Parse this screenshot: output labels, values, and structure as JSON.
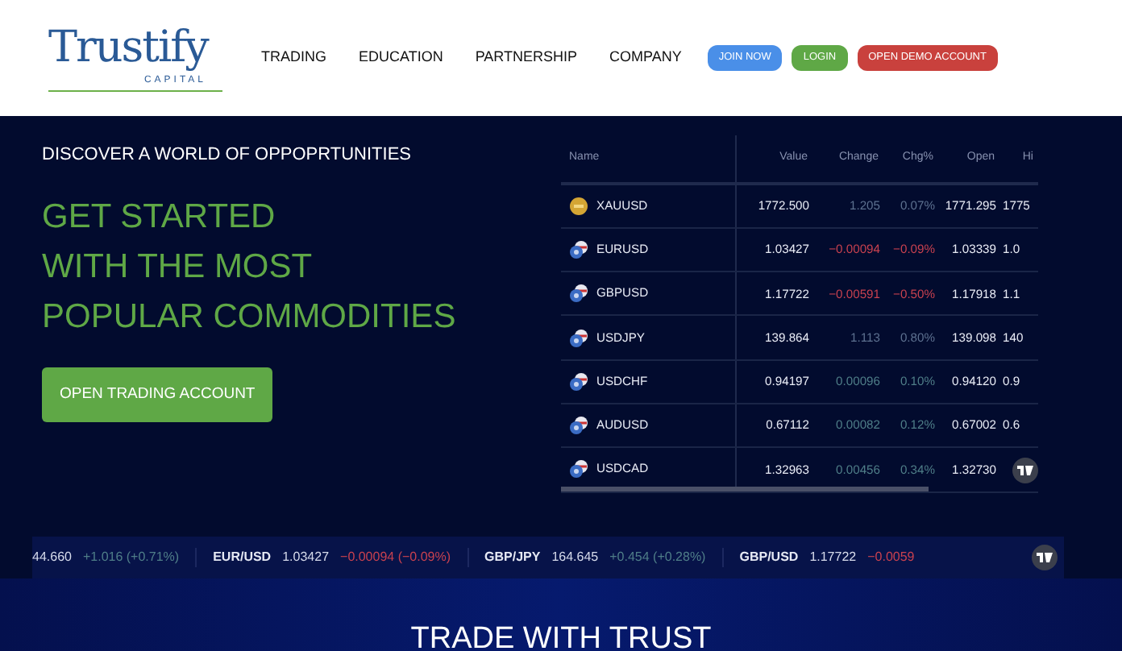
{
  "header": {
    "logo": {
      "wordmark": "Trustify",
      "tagline": "CAPITAL"
    },
    "nav": [
      {
        "label": "TRADING"
      },
      {
        "label": "EDUCATION"
      },
      {
        "label": "PARTNERSHIP"
      },
      {
        "label": "COMPANY"
      }
    ],
    "buttons": [
      {
        "label": "JOIN NOW",
        "kind": "join"
      },
      {
        "label": "LOGIN",
        "kind": "login"
      },
      {
        "label": "OPEN DEMO ACCOUNT",
        "kind": "demo"
      }
    ]
  },
  "hero": {
    "eyebrow": "DISCOVER A WORLD OF OPPOPRTUNITIES",
    "headline": [
      "GET STARTED",
      "WITH THE MOST",
      "POPULAR COMMODITIES"
    ],
    "cta": "OPEN TRADING ACCOUNT"
  },
  "quotes_table": {
    "columns": [
      "Name",
      "Value",
      "Change",
      "Chg%",
      "Open",
      "Hi"
    ],
    "rows": [
      {
        "symbol": "XAUUSD",
        "kind": "gold",
        "color": "#5d7190",
        "value": "1772.500",
        "change": "1.205",
        "change_pct": "0.07%",
        "open": "1771.295",
        "high": "1775"
      },
      {
        "symbol": "EURUSD",
        "kind": "fx",
        "color": "#c8414f",
        "value": "1.03427",
        "change": "−0.00094",
        "change_pct": "−0.09%",
        "open": "1.03339",
        "high": "1.0"
      },
      {
        "symbol": "GBPUSD",
        "kind": "fx",
        "color": "#c8414f",
        "value": "1.17722",
        "change": "−0.00591",
        "change_pct": "−0.50%",
        "open": "1.17918",
        "high": "1.1"
      },
      {
        "symbol": "USDJPY",
        "kind": "fx",
        "color": "#5d7190",
        "value": "139.864",
        "change": "1.113",
        "change_pct": "0.80%",
        "open": "139.098",
        "high": "140"
      },
      {
        "symbol": "USDCHF",
        "kind": "fx",
        "color": "#4f7e88",
        "value": "0.94197",
        "change": "0.00096",
        "change_pct": "0.10%",
        "open": "0.94120",
        "high": "0.9"
      },
      {
        "symbol": "AUDUSD",
        "kind": "fx",
        "color": "#4f7e88",
        "value": "0.67112",
        "change": "0.00082",
        "change_pct": "0.12%",
        "open": "0.67002",
        "high": "0.6"
      },
      {
        "symbol": "USDCAD",
        "kind": "fx",
        "color": "#4f7e88",
        "value": "1.32963",
        "change": "0.00456",
        "change_pct": "0.34%",
        "open": "1.32730"
      }
    ]
  },
  "ticker": [
    {
      "value": "44.660",
      "change": "+1.016 (+0.71%)",
      "color": "#4f7e88"
    },
    {
      "symbol": "EUR/USD",
      "value": "1.03427",
      "change": "−0.00094 (−0.09%)",
      "color": "#c8414f"
    },
    {
      "symbol": "GBP/JPY",
      "value": "164.645",
      "change": "+0.454 (+0.28%)",
      "color": "#4f7e88"
    },
    {
      "symbol": "GBP/USD",
      "value": "1.17722",
      "change": "−0.0059",
      "color": "#c8414f"
    }
  ],
  "section_title": "TRADE WITH TRUST"
}
